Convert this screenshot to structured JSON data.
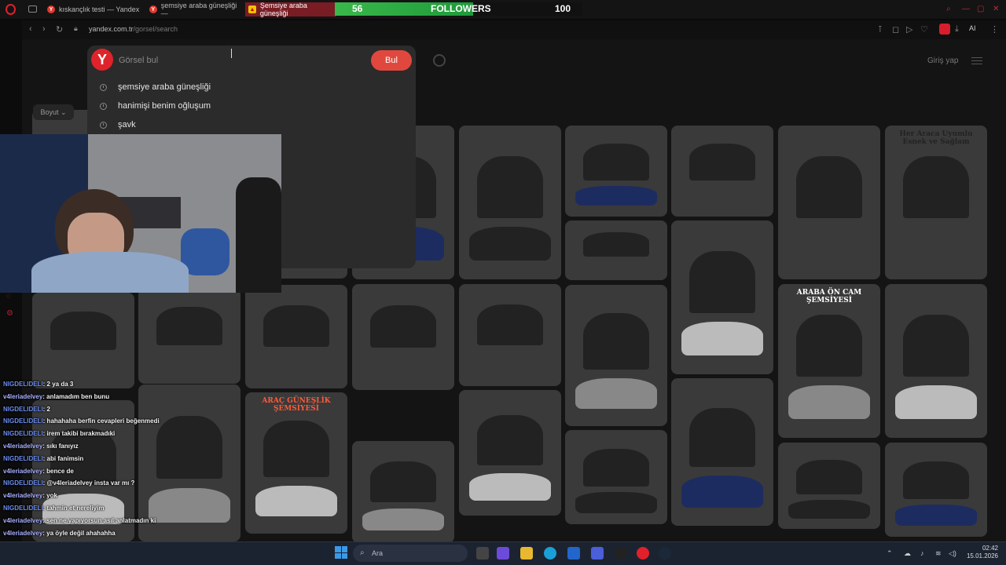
{
  "browser": {
    "tabs": [
      {
        "title": "kıskançlık testi — Yandex"
      },
      {
        "title": "şemsiye araba güneşliği —"
      },
      {
        "title": "Şemsiye araba güneşliği"
      }
    ],
    "address": {
      "host": "yandex.com.tr",
      "path": "/gorsel/search"
    },
    "toolbar_badge": "AI"
  },
  "overlay": {
    "followers_label": "FOLLOWERS",
    "followers_current": "56",
    "followers_goal": "100",
    "progress_fraction": 0.56
  },
  "search": {
    "placeholder": "Görsel bul",
    "button": "Bul",
    "suggestions": [
      {
        "text": "şemsiye araba güneşliği"
      },
      {
        "text": "hanimişi benim oğluşum"
      },
      {
        "text": "şavk"
      }
    ]
  },
  "header": {
    "login": "Giriş yap"
  },
  "filters": [
    {
      "label": "Boyut ⌄"
    }
  ],
  "images": [
    {
      "label": "Her Araca Uyumlu Esnek ve Sağlam"
    },
    {
      "label": "ARABA ÖN CAM ŞEMSİYESİ"
    },
    {
      "label": "ARAÇ GÜNEŞLİK ŞEMSİYESİ"
    }
  ],
  "chat": {
    "messages": [
      {
        "user": "NIGDELIDELI",
        "text": ": 2 ya da 3"
      },
      {
        "user": "v4leriadelvey",
        "text": ": anlamadım ben bunu"
      },
      {
        "user": "NIGDELIDELI",
        "text": ": 2"
      },
      {
        "user": "NIGDELIDELI",
        "text": ": hahahaha berfin cevapleri beğenmedi"
      },
      {
        "user": "NIGDELIDELI",
        "text": ": irem takibi bırakmadıki"
      },
      {
        "user": "v4leriadelvey",
        "text": ": sıkı fanıyız"
      },
      {
        "user": "NIGDELIDELI",
        "text": ": abi fanimsin"
      },
      {
        "user": "v4leriadelvey",
        "text": ": bence de"
      },
      {
        "user": "NIGDELIDELI",
        "text": ": @v4leriadelvey insta var mı ?"
      },
      {
        "user": "v4leriadelvey",
        "text": ": yok"
      },
      {
        "user": "NIGDELIDELI",
        "text": ": tahmin et nereliyim"
      },
      {
        "user": "v4leriadelvey",
        "text": ": sen ne yapıyorsun asıl anlatmadın ki"
      },
      {
        "user": "v4leriadelvey",
        "text": ": ya öyle değil ahahahha"
      }
    ]
  },
  "taskbar": {
    "search_label": "Ara",
    "time": "02:42",
    "date": "15.01.2026"
  },
  "colors": {
    "accent": "#e0232b",
    "progress": "#3ab84a",
    "search_button": "#e0483e"
  }
}
